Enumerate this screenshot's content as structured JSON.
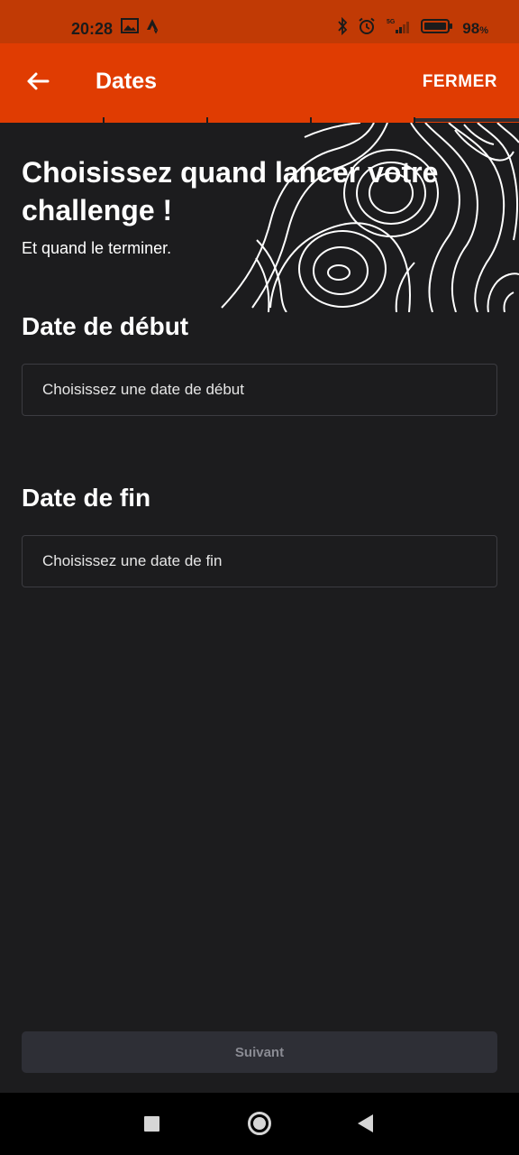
{
  "status_bar": {
    "time": "20:28",
    "battery_value": "98",
    "battery_unit": "%",
    "network_label": "5G",
    "icons": [
      "gallery-icon",
      "strava-icon",
      "bluetooth-icon",
      "alarm-icon",
      "signal-icon",
      "battery-icon"
    ]
  },
  "app_bar": {
    "title": "Dates",
    "close_label": "FERMER",
    "back_icon": "arrow-left-icon",
    "background_color": "#e03c02"
  },
  "steps": {
    "total": 5,
    "current": 5
  },
  "content": {
    "headline": "Choisissez quand lancer votre challenge !",
    "subline": "Et quand le terminer.",
    "start": {
      "label": "Date de début",
      "placeholder": "Choisissez une date de début"
    },
    "end": {
      "label": "Date de fin",
      "placeholder": "Choisissez une date de fin"
    }
  },
  "footer": {
    "next_label": "Suivant"
  },
  "nav_bar": {
    "icons": [
      "recent-apps-icon",
      "home-icon",
      "back-icon"
    ]
  }
}
